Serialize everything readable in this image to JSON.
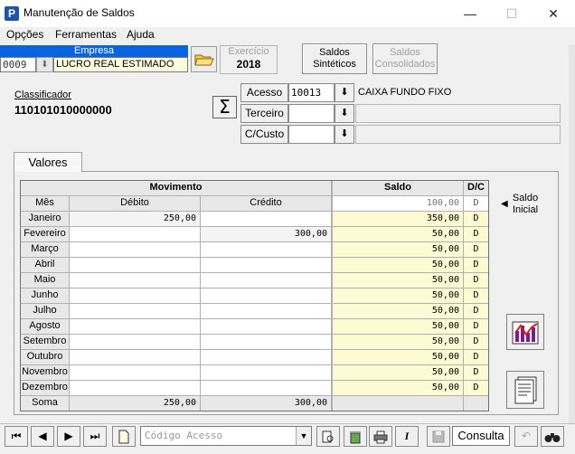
{
  "window": {
    "title": "Manutenção de Saldos",
    "icon_letter": "P",
    "minimize": "—",
    "maximize": "☐",
    "close": "✕"
  },
  "menu": {
    "items": [
      "Opções",
      "Ferramentas",
      "Ajuda"
    ]
  },
  "empresa": {
    "label": "Empresa",
    "code": "0009",
    "name": "LUCRO REAL ESTIMADO"
  },
  "exercicio": {
    "label": "Exercício",
    "value": "2018"
  },
  "buttons": {
    "saldos_sinteticos": [
      "Saldos",
      "Sintéticos"
    ],
    "saldos_consolidados": [
      "Saldos",
      "Consolidados"
    ]
  },
  "classificador": {
    "label": "Classificador",
    "value": "110101010000000"
  },
  "sigma": "Σ",
  "fields": {
    "acesso": {
      "label": "Acesso",
      "value": "10013",
      "description": "CAIXA FUNDO FIXO"
    },
    "terceiro": {
      "label": "Terceiro",
      "value": "",
      "description": ""
    },
    "ccusto": {
      "label": "C/Custo",
      "value": "",
      "description": ""
    }
  },
  "tab": {
    "label": "Valores"
  },
  "grid": {
    "group_headers": {
      "movimento": "Movimento",
      "saldo": "Saldo",
      "dc": "D/C"
    },
    "col_headers": {
      "mes": "Mês",
      "debito": "Débito",
      "credito": "Crédito"
    },
    "initial": {
      "saldo": "100,00",
      "dc": "D"
    },
    "rows": [
      {
        "mes": "Janeiro",
        "debito": "250,00",
        "credito": "",
        "saldo": "350,00",
        "dc": "D"
      },
      {
        "mes": "Fevereiro",
        "debito": "",
        "credito": "300,00",
        "saldo": "50,00",
        "dc": "D"
      },
      {
        "mes": "Março",
        "debito": "",
        "credito": "",
        "saldo": "50,00",
        "dc": "D"
      },
      {
        "mes": "Abril",
        "debito": "",
        "credito": "",
        "saldo": "50,00",
        "dc": "D"
      },
      {
        "mes": "Maio",
        "debito": "",
        "credito": "",
        "saldo": "50,00",
        "dc": "D"
      },
      {
        "mes": "Junho",
        "debito": "",
        "credito": "",
        "saldo": "50,00",
        "dc": "D"
      },
      {
        "mes": "Julho",
        "debito": "",
        "credito": "",
        "saldo": "50,00",
        "dc": "D"
      },
      {
        "mes": "Agosto",
        "debito": "",
        "credito": "",
        "saldo": "50,00",
        "dc": "D"
      },
      {
        "mes": "Setembro",
        "debito": "",
        "credito": "",
        "saldo": "50,00",
        "dc": "D"
      },
      {
        "mes": "Outubro",
        "debito": "",
        "credito": "",
        "saldo": "50,00",
        "dc": "D"
      },
      {
        "mes": "Novembro",
        "debito": "",
        "credito": "",
        "saldo": "50,00",
        "dc": "D"
      },
      {
        "mes": "Dezembro",
        "debito": "",
        "credito": "",
        "saldo": "50,00",
        "dc": "D"
      }
    ],
    "total": {
      "mes": "Soma",
      "debito": "250,00",
      "credito": "300,00",
      "saldo": "",
      "dc": ""
    }
  },
  "saldo_inicial": {
    "arrow": "◀",
    "label": [
      "Saldo",
      "Inicial"
    ]
  },
  "navigator": {
    "first": "⏮",
    "prev": "◀",
    "next": "▶",
    "last": "⏭",
    "search_placeholder": "Código Acesso",
    "mode": "Consulta"
  },
  "colors": {
    "accent": "#0a64e0",
    "saldo_bg": "#fdfbd4",
    "input_yellow": "#fffde0"
  }
}
